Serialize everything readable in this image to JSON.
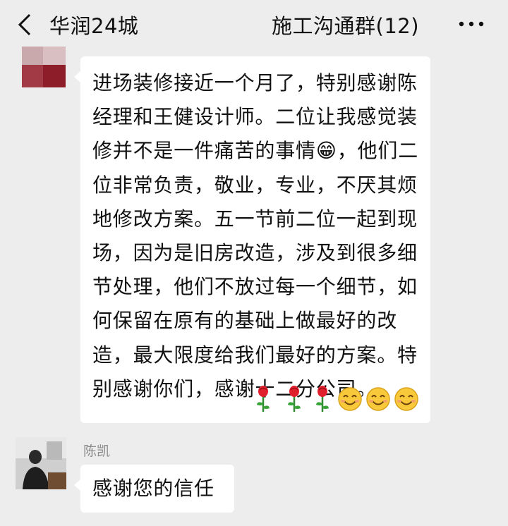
{
  "header": {
    "title_left": "华润24城",
    "title_right": "施工沟通群(12)"
  },
  "messages": [
    {
      "text": "进场装修接近一个月了，特别感谢陈经理和王健设计师。二位让我感觉装修并不是一件痛苦的事情😁，他们二位非常负责，敬业，专业，不厌其烦地修改方案。五一节前二位一起到现场，因为是旧房改造，涉及到很多细节处理，他们不放过每一个细节，如何保留在原有的基础上做最好的改造，最大限度给我们最好的方案。特别感谢你们，感谢十二分公司。",
      "emojis": [
        "rose-icon",
        "rose-icon",
        "rose-icon",
        "smile-icon",
        "smile-icon",
        "smile-icon"
      ]
    },
    {
      "sender": "陈凯",
      "text": "感谢您的信任"
    }
  ],
  "colors": {
    "background": "#ededed",
    "bubble": "#ffffff",
    "text": "#111111",
    "sender": "#8a8a8a"
  }
}
